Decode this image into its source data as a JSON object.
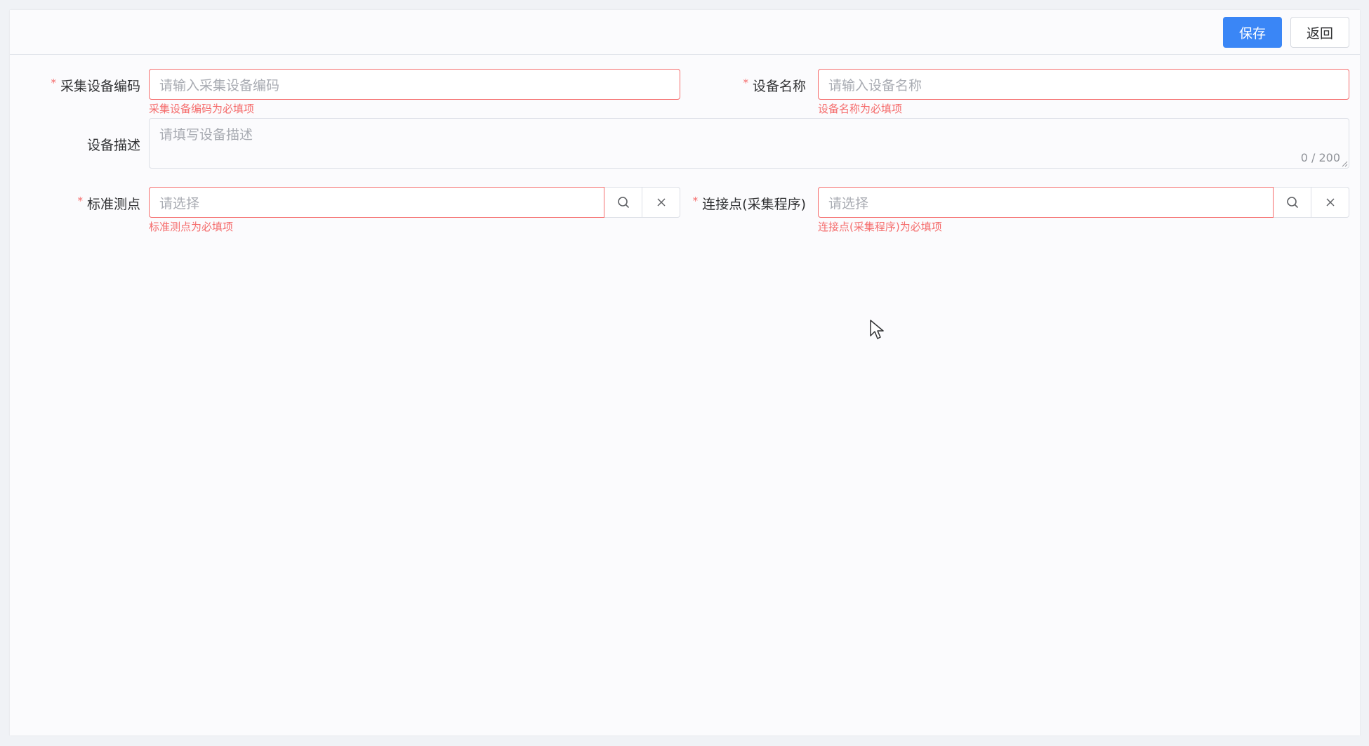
{
  "toolbar": {
    "save_label": "保存",
    "back_label": "返回"
  },
  "form": {
    "device_code": {
      "label": "采集设备编码",
      "required": "*",
      "placeholder": "请输入采集设备编码",
      "error": "采集设备编码为必填项"
    },
    "device_name": {
      "label": "设备名称",
      "required": "*",
      "placeholder": "请输入设备名称",
      "error": "设备名称为必填项"
    },
    "device_desc": {
      "label": "设备描述",
      "placeholder": "请填写设备描述",
      "counter": "0 / 200"
    },
    "standard_point": {
      "label": "标准测点",
      "required": "*",
      "placeholder": "请选择",
      "error": "标准测点为必填项",
      "search_icon": "search-icon",
      "clear_icon": "close-icon"
    },
    "connection_point": {
      "label": "连接点(采集程序)",
      "required": "*",
      "placeholder": "请选择",
      "error": "连接点(采集程序)为必填项",
      "search_icon": "search-icon",
      "clear_icon": "close-icon"
    }
  },
  "colors": {
    "primary": "#3a86f6",
    "error": "#f56c6c",
    "placeholder": "#a8abb2",
    "panel_bg": "#fbfbfd"
  }
}
